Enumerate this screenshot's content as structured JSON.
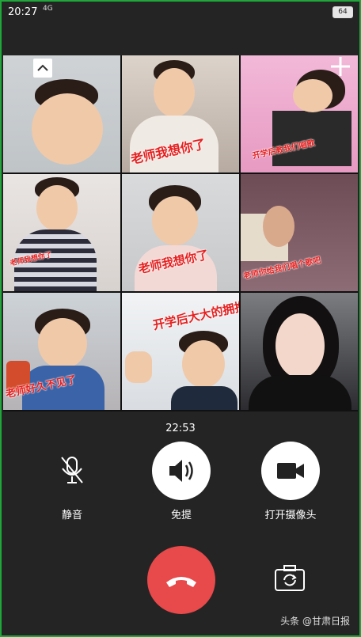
{
  "status_bar": {
    "time": "20:27",
    "signal": "4G",
    "battery": "64"
  },
  "call": {
    "duration": "22:53"
  },
  "tiles": [
    {
      "caption": ""
    },
    {
      "caption": "老师我想你了"
    },
    {
      "caption": "开学后教我们唱歌"
    },
    {
      "caption": "老师我想你了"
    },
    {
      "caption": "老师我想你了"
    },
    {
      "caption": "老师你给我们唱个歌吧"
    },
    {
      "caption": "老师好久不见了"
    },
    {
      "caption": "开学后大大的拥抱"
    },
    {
      "caption": ""
    }
  ],
  "controls": {
    "mute_label": "静音",
    "speaker_label": "免提",
    "camera_label": "打开摄像头"
  },
  "watermark": {
    "prefix": "头条",
    "name": "甘肃日报"
  },
  "colors": {
    "end_call": "#e8494a",
    "active_button": "#ffffff",
    "inactive_button": "transparent",
    "caption_red": "#e61f1f"
  }
}
